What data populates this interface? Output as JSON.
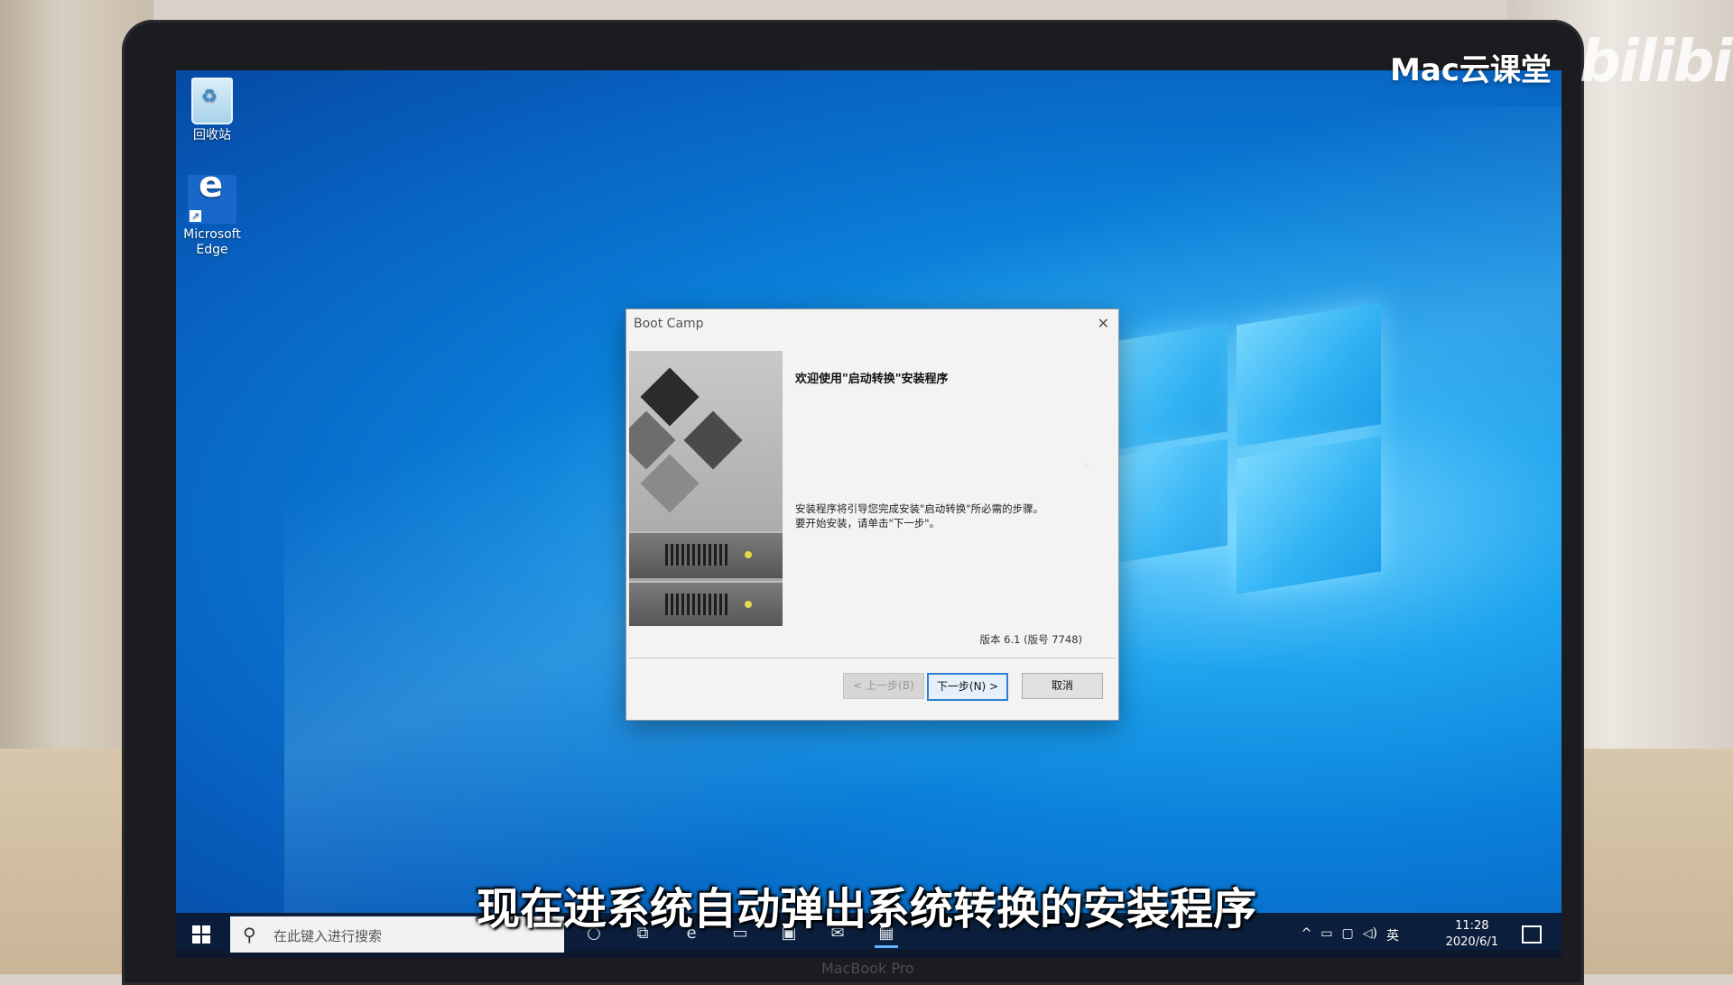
{
  "desktop": {
    "icons": [
      {
        "label": "回收站"
      },
      {
        "label": "Microsoft\nEdge"
      }
    ]
  },
  "dialog": {
    "title": "Boot Camp",
    "heading": "欢迎使用\"启动转换\"安装程序",
    "body_line1": "安装程序将引导您完成安装\"启动转换\"所必需的步骤。",
    "body_line2": "要开始安装，请单击\"下一步\"。",
    "version": "版本 6.1 (版号 7748)",
    "buttons": {
      "back": "< 上一步(B)",
      "next": "下一步(N) >",
      "cancel": "取消"
    }
  },
  "taskbar": {
    "search_placeholder": "在此键入进行搜索",
    "tray_lang": "英",
    "clock_time": "11:28",
    "clock_date": "2020/6/1"
  },
  "overlay": {
    "watermark": "Mac云课堂",
    "logo": "bilibili",
    "subtitle": "现在进系统自动弹出系统转换的安装程序",
    "laptop_label": "MacBook Pro"
  },
  "colors": {
    "desktop_blue": "#0a7fd8",
    "accent": "#2f7fd2",
    "taskbar": "#0c1830"
  }
}
